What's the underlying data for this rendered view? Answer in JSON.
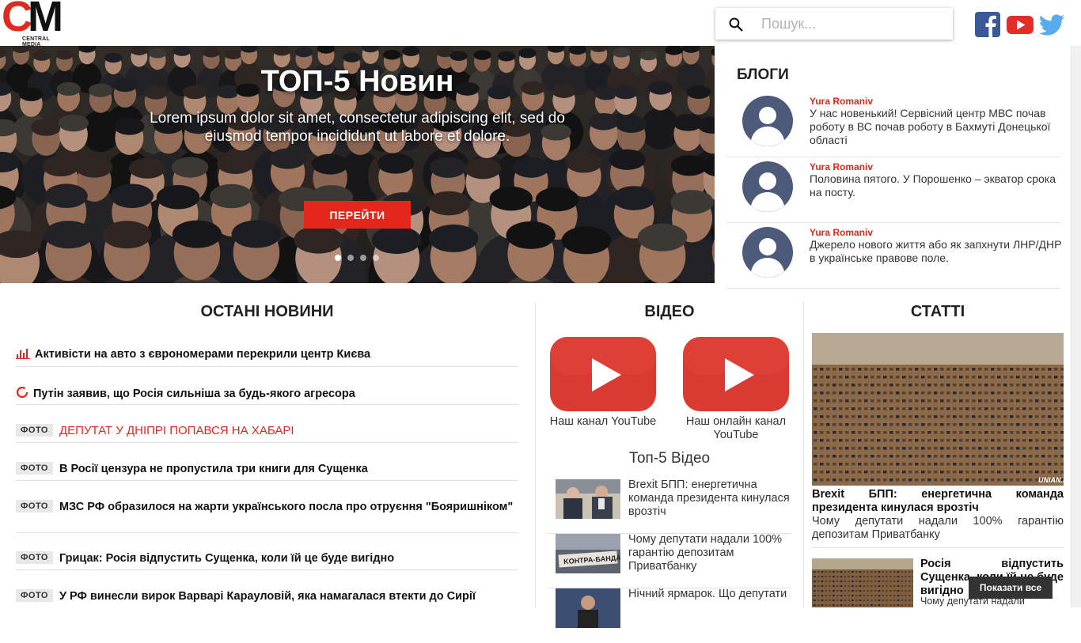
{
  "logo": {
    "letters_c": "C",
    "letters_m": "M",
    "subtitle": "CENTRAL MEDIA"
  },
  "search": {
    "placeholder": "Пошук..."
  },
  "social": [
    "facebook-icon",
    "youtube-icon",
    "twitter-icon"
  ],
  "hero": {
    "title": "ТОП-5 Новин",
    "text": "Lorem ipsum dolor sit amet, consectetur adipiscing elit, sed do eiusmod tempor incididunt ut labore et dolore.",
    "button": "ПЕРЕЙТИ",
    "slides": 4,
    "active_slide": 1
  },
  "blogs": {
    "title": "БЛОГИ",
    "items": [
      {
        "author": "Yura Romaniv",
        "text": "У нас новенький! Сервісний центр МВС почав роботу в ВС почав роботу в Бахмуті Донецької області"
      },
      {
        "author": "Yura Romaniv",
        "text": "Половина пятого. У Порошенко – экватор срока на посту."
      },
      {
        "author": "Yura Romaniv",
        "text": "Джерело нового життя або як запхнути ЛНР/ДНР в українське правове поле."
      }
    ]
  },
  "news": {
    "title": "ОСТАНІ НОВИНИ",
    "items": [
      {
        "icon": "bar-chart-icon",
        "badge": "",
        "text": "Активісти на авто з єврономерами перекрили центр Києва",
        "red": false
      },
      {
        "icon": "ring-icon",
        "badge": "",
        "text": "Путін заявив, що Росія сильніша за будь-якого агресора",
        "red": false
      },
      {
        "icon": "",
        "badge": "ФОТО",
        "text": "ДЕПУТАТ У ДНІПРІ ПОПАВСЯ НА ХАБАРІ",
        "red": true
      },
      {
        "icon": "",
        "badge": "ФОТО",
        "text": "В Росії цензура не пропустила три книги для Сущенка",
        "red": false
      },
      {
        "icon": "",
        "badge": "ФОТО",
        "text": "МЗС РФ образилося на жарти українського посла про отруєння \"Бояришніком\"",
        "red": false
      },
      {
        "icon": "",
        "badge": "ФОТО",
        "text": "Грицак: Росія відпустить Сущенка, коли їй це буде вигідно",
        "red": false
      },
      {
        "icon": "",
        "badge": "ФОТО",
        "text": "У РФ винесли вирок Варварі Карауловій, яка намагалася втекти до Сирії",
        "red": false
      }
    ]
  },
  "video": {
    "title": "ВІДЕО",
    "channels": [
      {
        "label": "Наш канал YouTube"
      },
      {
        "label": "Наш онлайн канал YouTube"
      }
    ],
    "top5_title": "Топ-5 Відео",
    "items": [
      {
        "text": "Brexit БПП: енергетична команда президента кинулася врозтіч"
      },
      {
        "text": "Чому депутати надали 100% гарантію депозитам Приватбанку"
      },
      {
        "text": "Нічний ярмарок. Що депутати"
      }
    ]
  },
  "articles": {
    "title": "СТАТТІ",
    "main": {
      "title": "Brexit БПП: енергетична команда президента кинулася врозтіч",
      "desc": "Чому депутати надали 100% гарантію депозитам Приватбанку"
    },
    "second": {
      "title": "Росія відпустить Сущенка, коли їй це буде вигідно",
      "desc": "Чому депутати надали"
    },
    "show_all": "Показати все"
  },
  "colors": {
    "accent": "#e5261c",
    "dark": "#333333"
  }
}
